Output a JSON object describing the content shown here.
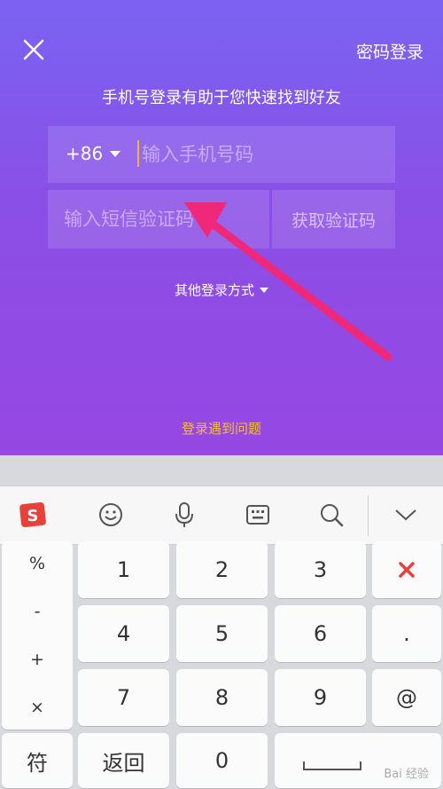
{
  "header": {
    "close_icon": "close-icon",
    "password_login": "密码登录",
    "headline": "手机号登录有助于您快速找到好友"
  },
  "form": {
    "country_code": "+86",
    "phone_placeholder": "输入手机号码",
    "sms_placeholder": "输入短信验证码",
    "get_code": "获取验证码",
    "other_login": "其他登录方式",
    "trouble": "登录遇到问题"
  },
  "colors": {
    "accent_orange": "#f7b94a",
    "arrow_pink": "#f0287a",
    "delete_red": "#e8403a"
  },
  "keyboard": {
    "toolbar_icons": [
      "sogou-logo-icon",
      "emoji-icon",
      "microphone-icon",
      "keyboard-icon",
      "search-icon",
      "collapse-icon"
    ],
    "symbols": [
      "%",
      "-",
      "+",
      "×"
    ],
    "digits": [
      "1",
      "2",
      "3",
      "4",
      "5",
      "6",
      "7",
      "8",
      "9",
      "0"
    ],
    "dot": ".",
    "at": "@",
    "symbol_key": "符",
    "return_key": "返回",
    "delete_icon": "delete-icon",
    "watermark": "Bai 经验"
  }
}
